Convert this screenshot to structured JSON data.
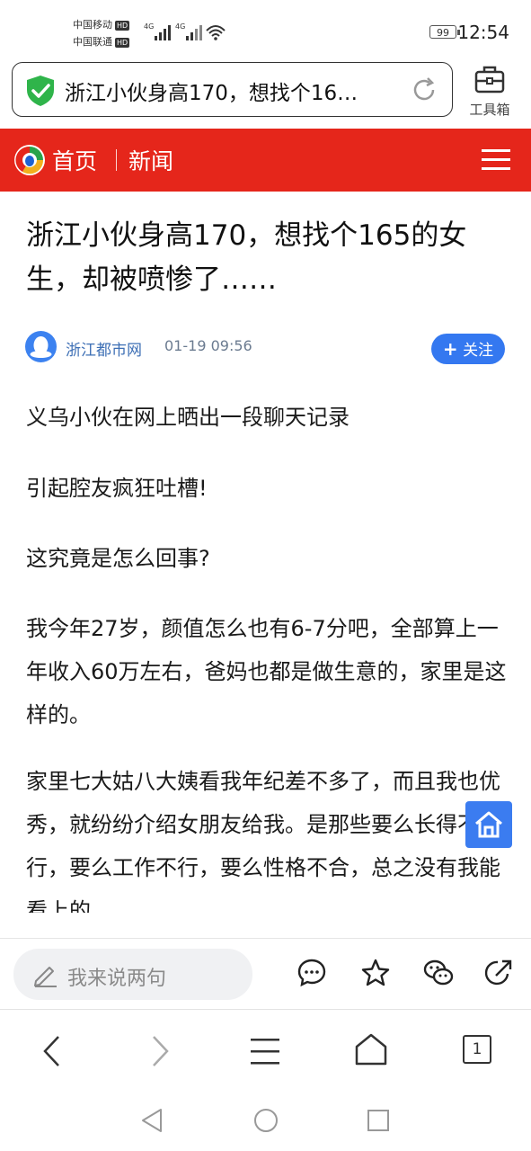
{
  "status_bar": {
    "carrier1": "中国移动",
    "carrier2": "中国联通",
    "hd": "HD",
    "signal1": "4G",
    "signal2": "4G",
    "battery": "99",
    "time": "12:54"
  },
  "url_bar": {
    "url_text": "浙江小伙身高170，想找个16…",
    "toolbox_label": "工具箱"
  },
  "header": {
    "home_label": "首页",
    "news_label": "新闻",
    "accent_color": "#e5261b"
  },
  "article": {
    "title": "浙江小伙身高170，想找个165的女生，却被喷惨了……",
    "author": "浙江都市网",
    "time": "01-19 09:56",
    "follow_label": "关注",
    "paragraphs": [
      "义乌小伙在网上晒出一段聊天记录",
      "引起腔友疯狂吐槽!",
      "这究竟是怎么回事?",
      "我今年27岁，颜值怎么也有6-7分吧，全部算上一年收入60万左右，爸妈也都是做生意的，家里是这样的。",
      "家里七大姑八大姨看我年纪差不多了，而且我也优秀，就纷纷介绍女朋友给我。是那些要么长得不行，要么工作不行，要么性格不合，总之没有我能看上的。"
    ]
  },
  "comment_bar": {
    "placeholder": "我来说两句"
  },
  "browser_toolbar": {
    "tab_count": "1"
  },
  "icons": [
    "shield-icon",
    "reload-icon",
    "toolbox-icon",
    "tencent-logo",
    "menu-icon",
    "plus-icon",
    "home-icon",
    "pencil-icon",
    "comment-icon",
    "star-icon",
    "wechat-icon",
    "share-icon",
    "back-icon",
    "forward-icon",
    "browser-menu-icon",
    "browser-home-icon",
    "tabs-icon",
    "nav-back-icon",
    "nav-home-icon",
    "nav-recents-icon"
  ]
}
